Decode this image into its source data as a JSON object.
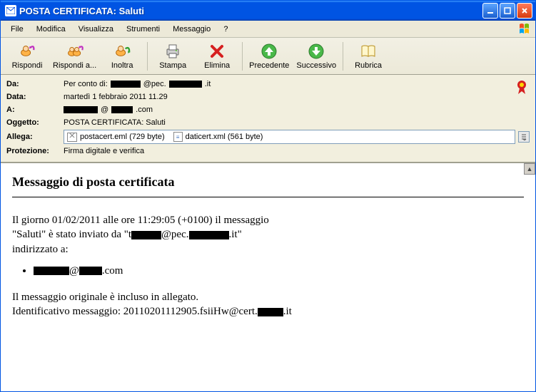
{
  "window": {
    "title": "POSTA CERTIFICATA: Saluti"
  },
  "menu": {
    "file": "File",
    "modifica": "Modifica",
    "visualizza": "Visualizza",
    "strumenti": "Strumenti",
    "messaggio": "Messaggio",
    "help": "?"
  },
  "toolbar": {
    "rispondi": "Rispondi",
    "rispondi_a": "Rispondi a...",
    "inoltra": "Inoltra",
    "stampa": "Stampa",
    "elimina": "Elimina",
    "precedente": "Precedente",
    "successivo": "Successivo",
    "rubrica": "Rubrica"
  },
  "headers": {
    "da_label": "Da:",
    "da_prefix": "Per conto di:",
    "da_mid": "@pec.",
    "da_suffix": ".it",
    "data_label": "Data:",
    "data_value": "martedì 1 febbraio 2011 11.29",
    "a_label": "A:",
    "a_mid": "@",
    "a_suffix": ".com",
    "oggetto_label": "Oggetto:",
    "oggetto_value": "POSTA CERTIFICATA: Saluti",
    "allega_label": "Allega:",
    "attach1": "postacert.eml (729 byte)",
    "attach2": "daticert.xml (561 byte)",
    "protezione_label": "Protezione:",
    "protezione_value": "Firma digitale e verifica"
  },
  "body": {
    "title": "Messaggio di posta certificata",
    "line1_a": "Il giorno 01/02/2011 alle ore 11:29:05 (+0100) il messaggio",
    "line2_a": "\"Saluti\" è stato inviato da \"t",
    "line2_mid": "@pec.",
    "line2_end": ".it\"",
    "line3": "indirizzato a:",
    "recip_mid": "@",
    "recip_end": ".com",
    "footer1": "Il messaggio originale è incluso in allegato.",
    "footer2_a": "Identificativo messaggio: 20110201112905.fsiiHw@cert.",
    "footer2_b": ".it"
  }
}
